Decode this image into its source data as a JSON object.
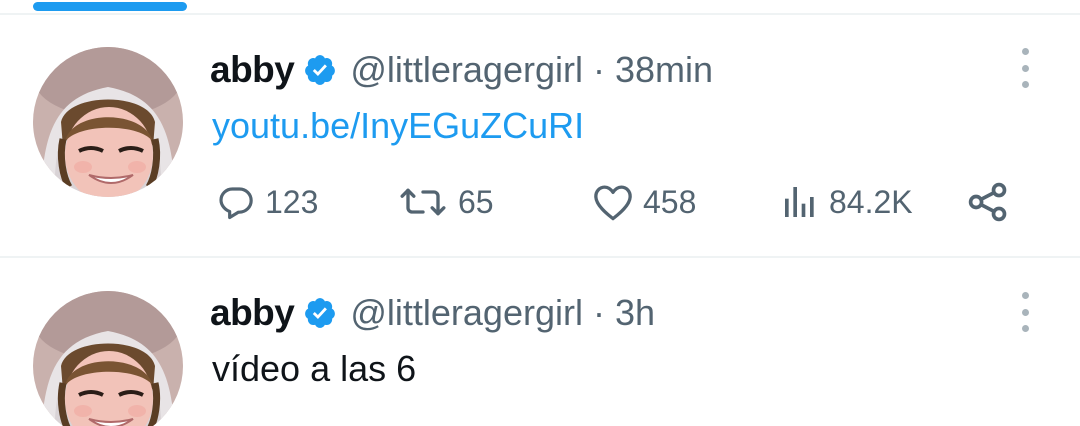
{
  "colors": {
    "accent": "#1d9bf0",
    "text_primary": "#0f1419",
    "text_secondary": "#536471",
    "divider": "#eff3f4"
  },
  "tweets": [
    {
      "display_name": "abby",
      "verified_icon": "verified-badge-icon",
      "handle": "@littleragergirl",
      "separator": "·",
      "time": "38min",
      "text": "youtu.be/InyEGuZCuRI",
      "actions": {
        "reply_count": "123",
        "retweet_count": "65",
        "like_count": "458",
        "view_count": "84.2K"
      }
    },
    {
      "display_name": "abby",
      "verified_icon": "verified-badge-icon",
      "handle": "@littleragergirl",
      "separator": "·",
      "time": "3h",
      "text": "vídeo a las 6"
    }
  ]
}
